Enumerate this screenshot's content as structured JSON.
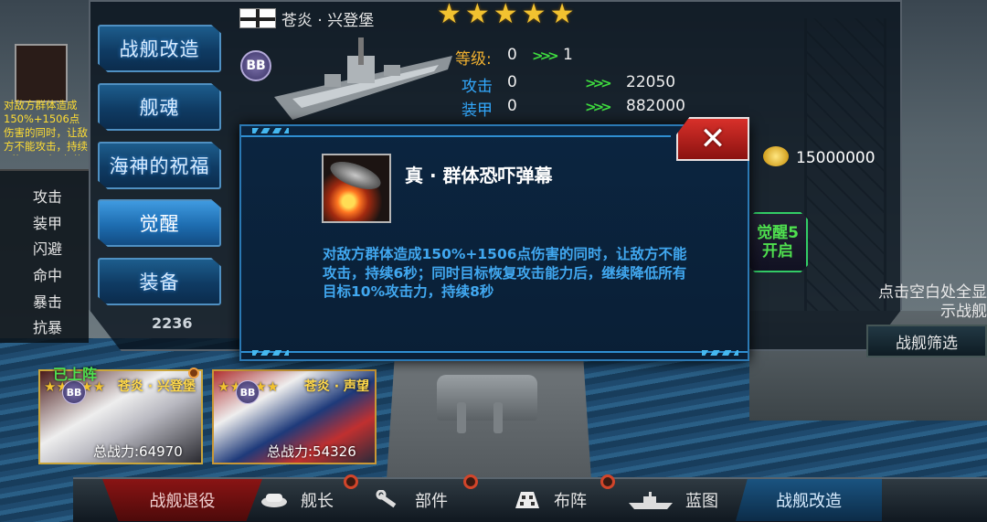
{
  "header": {
    "ship_name": "苍炎 · 兴登堡",
    "stars": "★★★★★",
    "type_badge": "BB"
  },
  "tabs": [
    {
      "label": "战舰改造",
      "active": false
    },
    {
      "label": "舰魂",
      "active": false
    },
    {
      "label": "海神的祝福",
      "active": false
    },
    {
      "label": "觉醒",
      "active": true
    },
    {
      "label": "装备",
      "active": false
    }
  ],
  "stats_compare": {
    "level_label": "等级:",
    "level_from": "0",
    "level_to": "1",
    "attack_label": "攻击",
    "attack_from": "0",
    "attack_to": "22050",
    "armor_label": "装甲",
    "armor_from": "0",
    "armor_to": "882000",
    "arrow": ">>>"
  },
  "gold": "15000000",
  "awaken5": {
    "line1": "觉醒5",
    "line2": "开启"
  },
  "awaken_button": "觉醒",
  "left_panel": {
    "desc": "对敌方群体造成150%+1506点伤害的同时，让敌方不能攻击，持续6秒；同时目标恢复攻击能力后，继续降低所有目标10%攻击力",
    "stats": [
      "攻击",
      "装甲",
      "闪避",
      "命中",
      "暴击",
      "抗暴"
    ],
    "power": "2236"
  },
  "right_panel": {
    "hint": "点击空白处全显示战舰",
    "filter_button": "战舰筛选"
  },
  "cards": [
    {
      "name": "苍炎 · 兴登堡",
      "badge": "BB",
      "power": "总战力:64970",
      "deployed": "已上阵",
      "stars": "★★★★★"
    },
    {
      "name": "苍炎 · 声望",
      "badge": "BB",
      "power": "总战力:54326",
      "stars": "★★★★★"
    }
  ],
  "bottom_nav": {
    "retire": "战舰退役",
    "captain": "舰长",
    "parts": "部件",
    "formation": "布阵",
    "blueprint": "蓝图",
    "modify": "战舰改造"
  },
  "dialog": {
    "skill_name": "真 · 群体恐吓弹幕",
    "skill_desc": "对敌方群体造成150%+1506点伤害的同时，让敌方不能攻击，持续6秒；同时目标恢复攻击能力后，继续降低所有目标10%攻击力，持续8秒",
    "close": "✕"
  },
  "colors": {
    "accent_blue": "#2b79b4",
    "gold_text": "#f2c230",
    "green_text": "#4fe04f",
    "close_red": "#d8302a"
  }
}
